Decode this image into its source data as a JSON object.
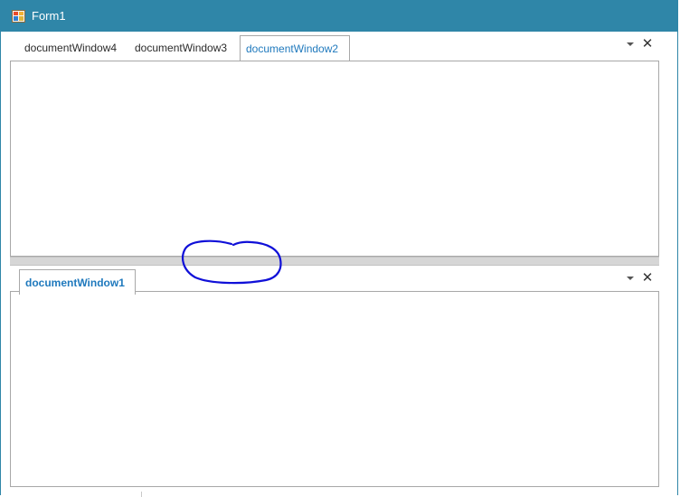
{
  "window": {
    "title": "Form1",
    "titlebar_color": "#2f86a8",
    "icon": "form-app-icon"
  },
  "top_group": {
    "tabs": [
      {
        "label": "documentWindow4",
        "active": false
      },
      {
        "label": "documentWindow3",
        "active": false
      },
      {
        "label": "documentWindow2",
        "active": true
      }
    ],
    "tools": {
      "dropdown_icon": "chevron-down-icon",
      "close_icon": "close-icon",
      "close_glyph": "✕"
    }
  },
  "bottom_group": {
    "tabs": [
      {
        "label": "documentWindow1",
        "active": true
      }
    ],
    "tools": {
      "dropdown_icon": "chevron-down-icon",
      "close_icon": "close-icon",
      "close_glyph": "✕"
    }
  },
  "colors": {
    "active_tab_text": "#1f79bd",
    "annotation_ink": "#1010d8",
    "splitter": "#d6d6d6"
  }
}
